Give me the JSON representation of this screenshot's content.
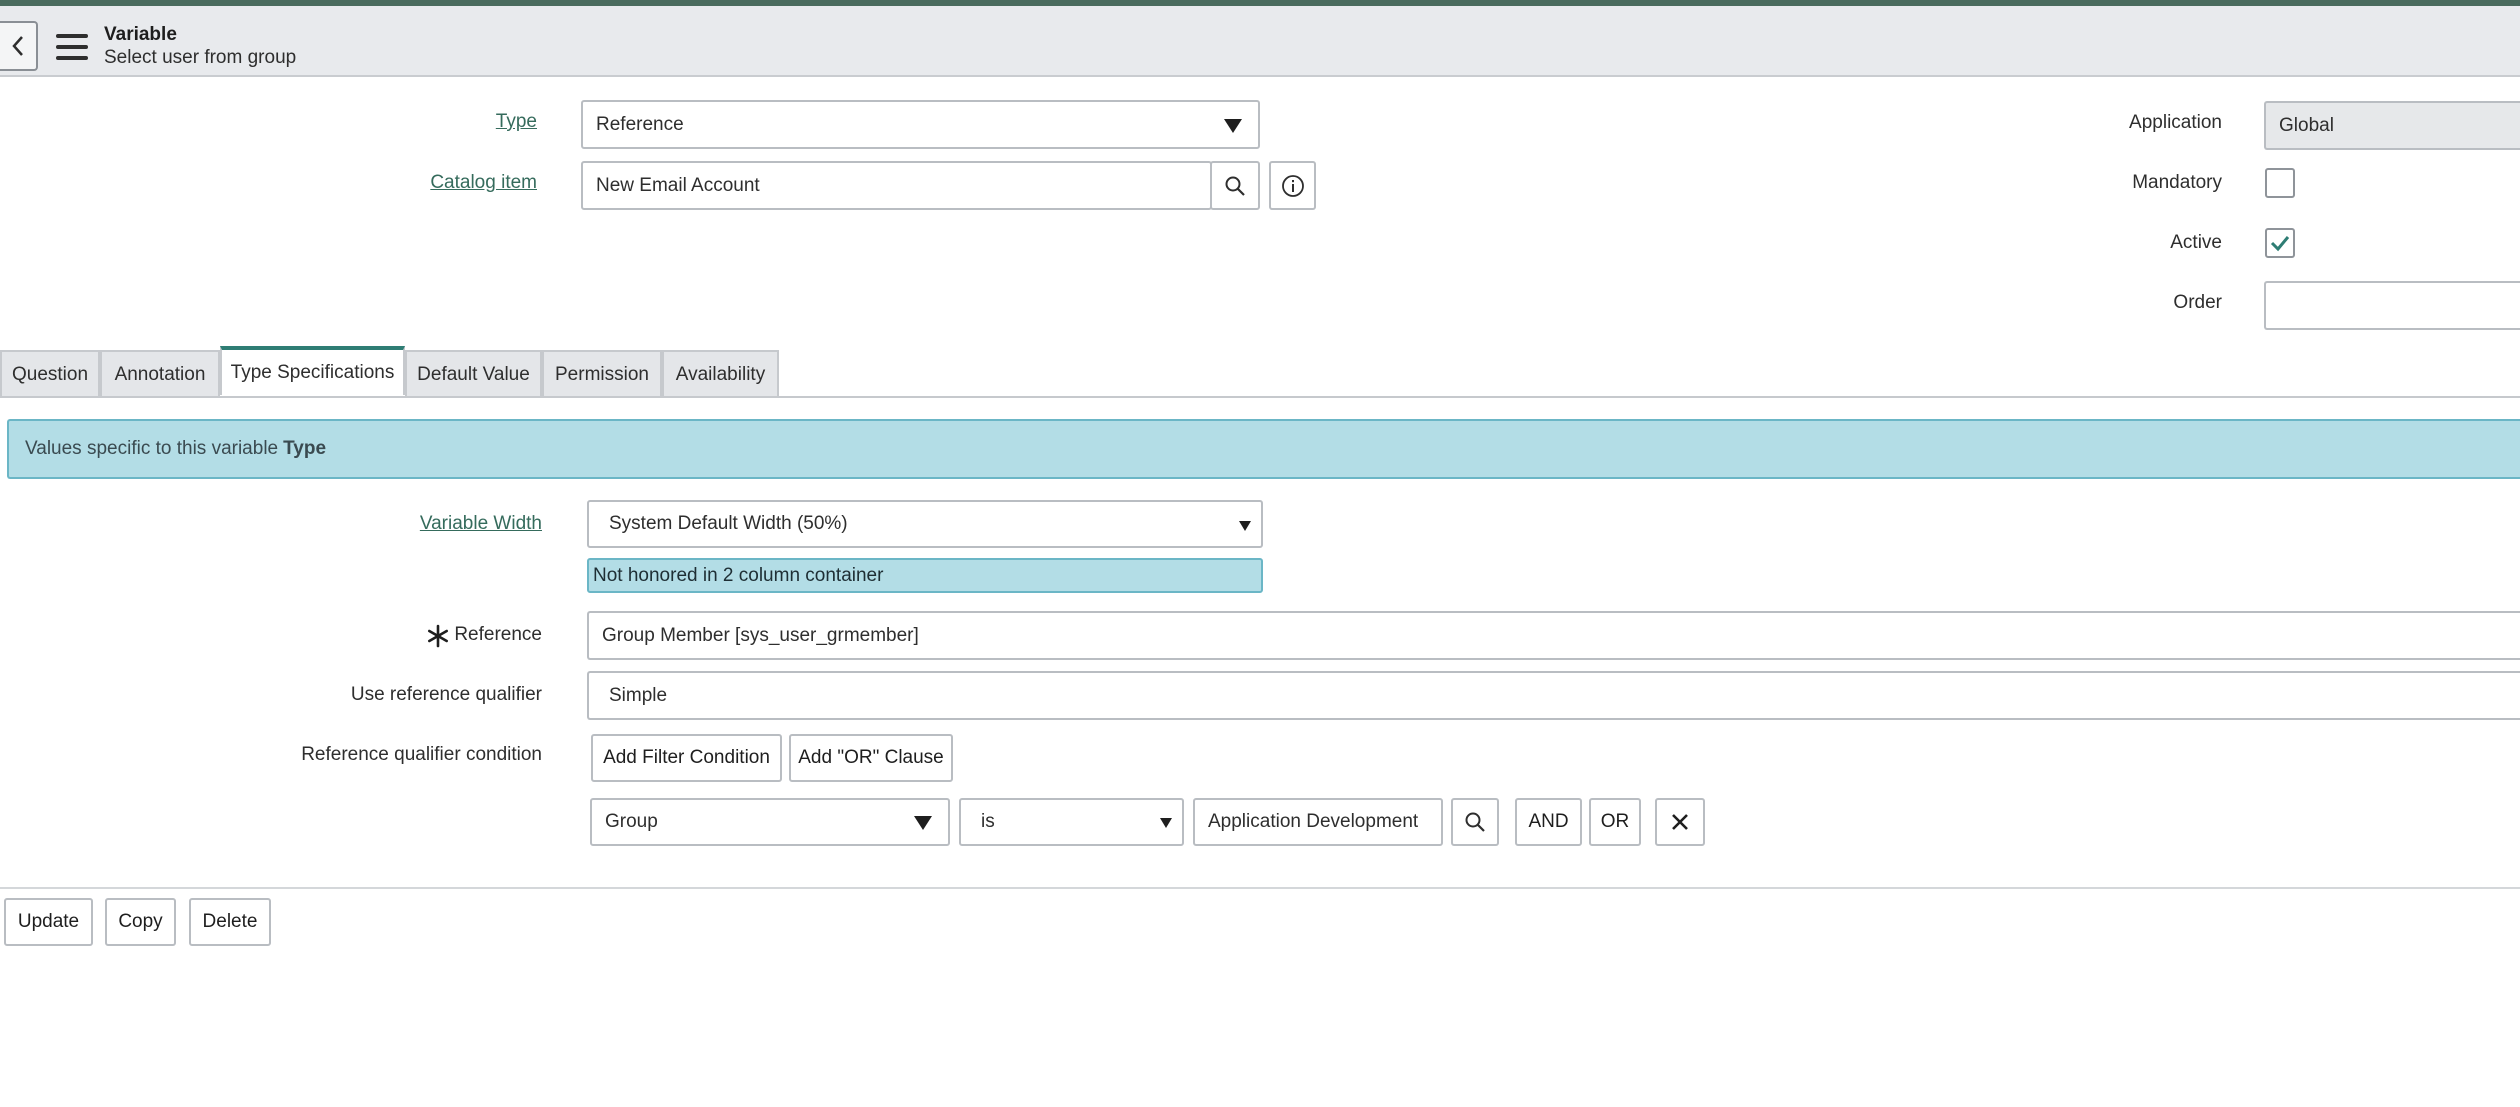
{
  "header": {
    "title": "Variable",
    "subtitle": "Select user from group",
    "back_icon": "chevron-left-icon",
    "menu_icon": "hamburger-menu-icon"
  },
  "form": {
    "type": {
      "label": "Type",
      "value": "Reference"
    },
    "catalog_item": {
      "label": "Catalog item",
      "value": "New Email Account"
    },
    "application": {
      "label": "Application",
      "value": "Global"
    },
    "mandatory": {
      "label": "Mandatory",
      "checked": false
    },
    "active": {
      "label": "Active",
      "checked": true
    },
    "order": {
      "label": "Order",
      "value": ""
    }
  },
  "tabs": [
    {
      "label": "Question"
    },
    {
      "label": "Annotation"
    },
    {
      "label": "Type Specifications",
      "active": true
    },
    {
      "label": "Default Value"
    },
    {
      "label": "Permission"
    },
    {
      "label": "Availability"
    }
  ],
  "type_spec": {
    "info_prefix": "Values specific to this variable",
    "info_bold": "Type",
    "variable_width": {
      "label": "Variable Width",
      "value": "System Default Width (50%)"
    },
    "width_note": "Not honored in 2 column container",
    "reference": {
      "label": "Reference",
      "value": "Group Member [sys_user_grmember]",
      "required_mark": "*"
    },
    "use_ref_qualifier": {
      "label": "Use reference qualifier",
      "value": "Simple"
    },
    "ref_qualifier_condition": {
      "label": "Reference qualifier condition",
      "add_filter_label": "Add Filter Condition",
      "add_or_label": "Add \"OR\" Clause",
      "field": "Group",
      "operator": "is",
      "value": "Application Development",
      "and_label": "AND",
      "or_label": "OR"
    }
  },
  "actions": {
    "update_label": "Update",
    "copy_label": "Copy",
    "delete_label": "Delete"
  },
  "colors": {
    "accent": "#2e7d74",
    "link": "#356b5c",
    "info_bg": "#b3dde6",
    "info_border": "#6bb6c6"
  }
}
